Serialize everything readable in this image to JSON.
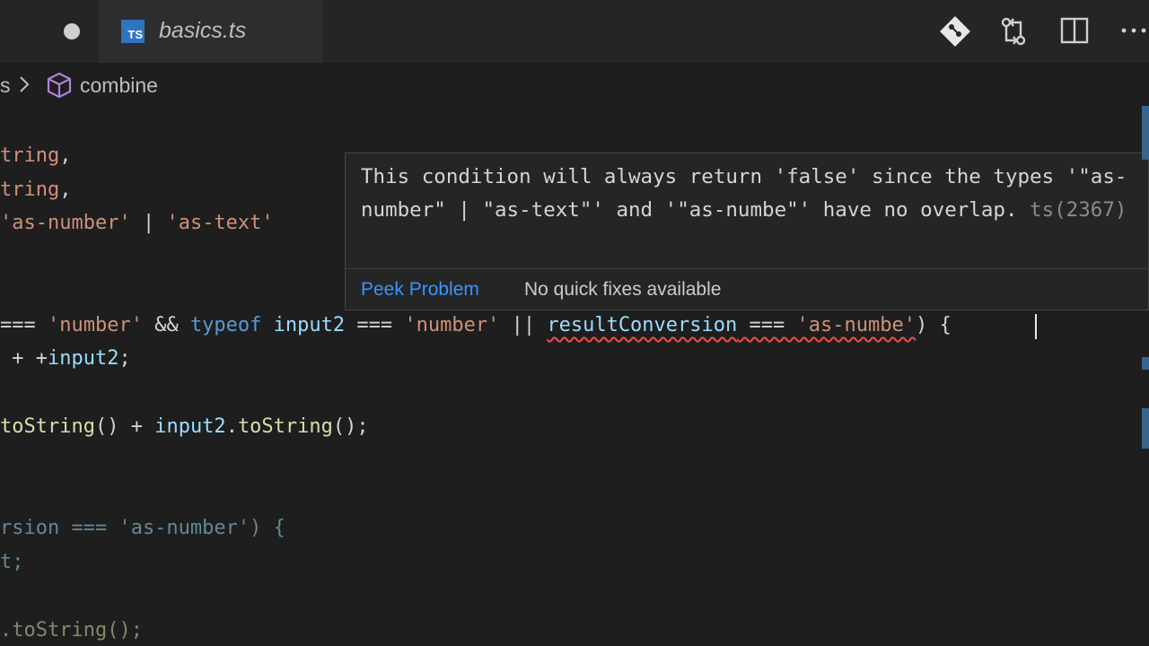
{
  "tab": {
    "title": "basics.ts",
    "icon_text": "TS"
  },
  "breadcrumb": {
    "prev_fragment": "s",
    "label": "combine"
  },
  "code": {
    "line1": {
      "a": "tring",
      "b": ","
    },
    "line2": {
      "a": "tring",
      "b": ","
    },
    "line3": {
      "a": "'as-number'",
      "b": " | ",
      "c": "'as-text'"
    },
    "line4": {
      "a": "=== ",
      "b": "'number'",
      "c": " && ",
      "d": "typeof",
      "e": " ",
      "f": "input2",
      "g": " === ",
      "h": "'number'",
      "i": " || ",
      "j": "resultConversion",
      "k": " === ",
      "l": "'as-numbe'",
      "m": ") {"
    },
    "line5": {
      "a": " + +",
      "b": "input2",
      "c": ";"
    },
    "line6": {
      "a": "toString",
      "b": "() + ",
      "c": "input2",
      "d": ".",
      "e": "toString",
      "f": "();"
    },
    "line7": {
      "a": "rsion === 'as-number') {"
    },
    "line8": {
      "a": "t;"
    },
    "line9": {
      "a": ".toString();"
    }
  },
  "hover": {
    "message": "This condition will always return 'false' since the types '\"as-number\" | \"as-text\"' and '\"as-numbe\"' have no overlap. ",
    "error_code": "ts(2367)",
    "peek_problem": "Peek Problem",
    "no_quick_fixes": "No quick fixes available"
  },
  "colors": {
    "background": "#1e1e1e",
    "string": "#ce9178",
    "keyword": "#569cd6",
    "variable": "#9cdcfe",
    "function": "#dcdcaa",
    "link": "#3794ff",
    "error": "#f14c4c"
  },
  "icons": [
    "dirty-dot-icon",
    "ts-file-icon",
    "source-control-icon",
    "compare-changes-icon",
    "split-editor-icon",
    "more-actions-icon",
    "chevron-right-icon",
    "method-cube-icon"
  ]
}
